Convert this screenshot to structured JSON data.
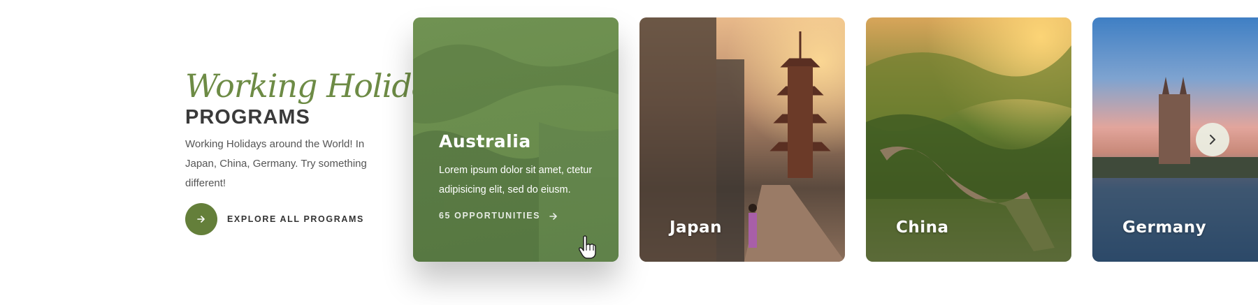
{
  "intro": {
    "script_title": "Working Holiday",
    "title": "PROGRAMS",
    "description": "Working Holidays around the World! In Japan, China, Germany. Try something different!",
    "explore_label": "EXPLORE ALL PROGRAMS"
  },
  "cards": [
    {
      "name": "Australia",
      "description": "Lorem ipsum dolor sit amet, ctetur adipisicing elit, sed do eiusm.",
      "opportunities": "65 OPPORTUNITIES"
    },
    {
      "name": "Japan"
    },
    {
      "name": "China"
    },
    {
      "name": "Germany"
    }
  ],
  "colors": {
    "accent": "#647f3a",
    "script": "#6d8b45",
    "overlay": "#688c4a"
  },
  "icons": {
    "explore": "arrow-right-icon",
    "opportunities": "arrow-right-icon",
    "next": "chevron-right-icon",
    "cursor": "hand-pointer-icon"
  }
}
